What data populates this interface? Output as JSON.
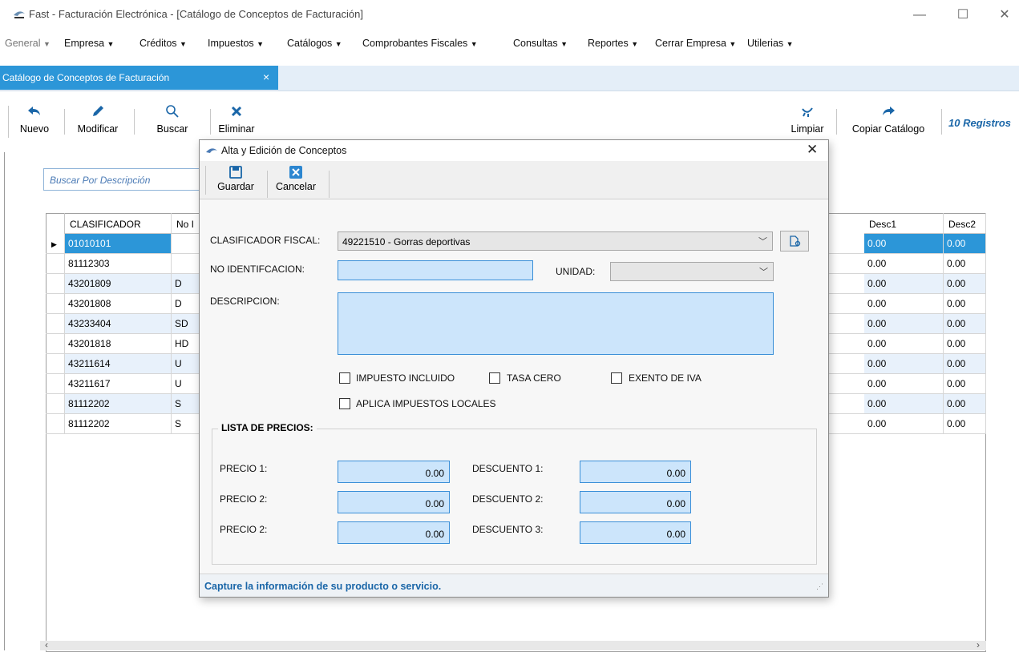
{
  "window": {
    "title": "Fast - Facturación Electrónica - [Catálogo de Conceptos de Facturación]",
    "minimize": "—",
    "maximize": "☐",
    "close": "✕"
  },
  "menu": [
    {
      "label": "General",
      "dim": true
    },
    {
      "label": "Empresa"
    },
    {
      "label": "Créditos"
    },
    {
      "label": "Impuestos"
    },
    {
      "label": "Catálogos"
    },
    {
      "label": "Comprobantes Fiscales"
    },
    {
      "label": "Consultas"
    },
    {
      "label": "Reportes"
    },
    {
      "label": "Cerrar Empresa"
    },
    {
      "label": "Utilerias"
    }
  ],
  "tab": {
    "label": "Catálogo de Conceptos de Facturación",
    "close": "×"
  },
  "toolbar": {
    "nuevo": "Nuevo",
    "modificar": "Modificar",
    "buscar": "Buscar",
    "eliminar": "Eliminar",
    "limpiar": "Limpiar",
    "copiar": "Copiar Catálogo",
    "registros": "10 Registros"
  },
  "search": {
    "placeholder": "Buscar Por Descripción"
  },
  "grid": {
    "headers": {
      "clasificador": "CLASIFICADOR",
      "no_id": "No I",
      "desc1": "Desc1",
      "desc2": "Desc2"
    },
    "rows": [
      {
        "clasificador": "01010101",
        "no_id": "",
        "desc1": "0.00",
        "desc2": "0.00"
      },
      {
        "clasificador": "81112303",
        "no_id": "",
        "desc1": "0.00",
        "desc2": "0.00"
      },
      {
        "clasificador": "43201809",
        "no_id": "D",
        "desc1": "0.00",
        "desc2": "0.00"
      },
      {
        "clasificador": "43201808",
        "no_id": "D",
        "desc1": "0.00",
        "desc2": "0.00"
      },
      {
        "clasificador": "43233404",
        "no_id": "SD",
        "desc1": "0.00",
        "desc2": "0.00"
      },
      {
        "clasificador": "43201818",
        "no_id": "HD",
        "desc1": "0.00",
        "desc2": "0.00"
      },
      {
        "clasificador": "43211614",
        "no_id": "U",
        "desc1": "0.00",
        "desc2": "0.00"
      },
      {
        "clasificador": "43211617",
        "no_id": "U",
        "desc1": "0.00",
        "desc2": "0.00"
      },
      {
        "clasificador": "81112202",
        "no_id": "S",
        "desc1": "0.00",
        "desc2": "0.00"
      },
      {
        "clasificador": "81112202",
        "no_id": "S",
        "desc1": "0.00",
        "desc2": "0.00"
      }
    ]
  },
  "dialog": {
    "title": "Alta y Edición de Conceptos",
    "close": "✕",
    "guardar": "Guardar",
    "cancelar": "Cancelar",
    "clasificador_label": "CLASIFICADOR FISCAL:",
    "clasificador_value": "49221510 - Gorras deportivas",
    "no_id_label": "NO IDENTIFCACION:",
    "unidad_label": "UNIDAD:",
    "descripcion_label": "DESCRIPCION:",
    "chk_impuesto": "IMPUESTO INCLUIDO",
    "chk_tasa": "TASA CERO",
    "chk_exento": "EXENTO DE IVA",
    "chk_locales": "APLICA IMPUESTOS LOCALES",
    "lista_precios": "LISTA DE PRECIOS:",
    "precio1_label": "PRECIO 1:",
    "precio2_label": "PRECIO 2:",
    "precio3_label": "PRECIO 2:",
    "descuento1_label": "DESCUENTO 1:",
    "descuento2_label": "DESCUENTO 2:",
    "descuento3_label": "DESCUENTO 3:",
    "precio1": "0.00",
    "precio2": "0.00",
    "precio3": "0.00",
    "descuento1": "0.00",
    "descuento2": "0.00",
    "descuento3": "0.00",
    "status": "Capture la información de su producto o servicio."
  },
  "colors": {
    "accent": "#2c96d8",
    "field": "#cce5fb",
    "link": "#1a66a8"
  }
}
